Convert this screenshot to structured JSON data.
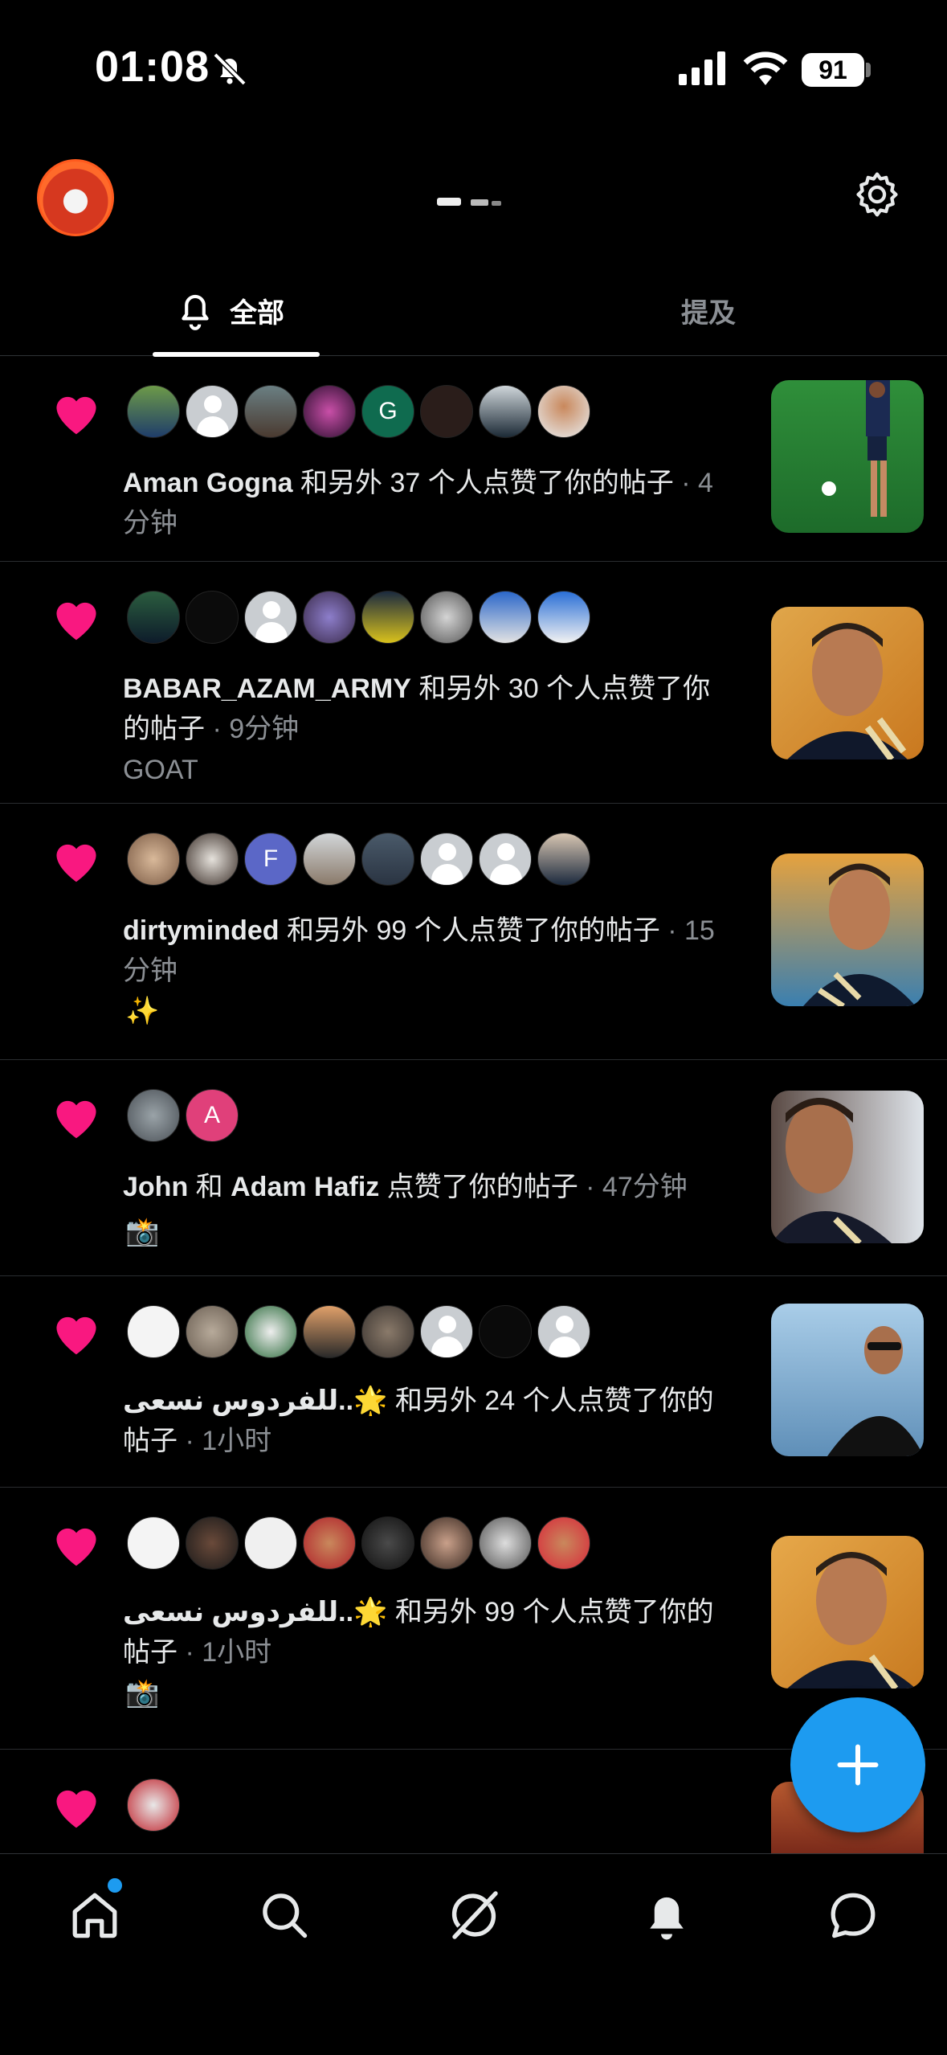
{
  "status_bar": {
    "time": "01:08",
    "battery": "91",
    "icons": [
      "bell-off-icon",
      "signal-icon",
      "wifi-icon",
      "battery-icon"
    ]
  },
  "header": {
    "avatar": "profile-avatar",
    "settings_icon": "gear-icon"
  },
  "tabs": [
    {
      "label": "全部",
      "icon": "bell-icon",
      "active": true
    },
    {
      "label": "提及",
      "active": false
    }
  ],
  "notifications": [
    {
      "name": "Aman Gogna",
      "action": " 和另外 37 个人点赞了你的帖子",
      "time": " · 4分钟",
      "sub": "",
      "emoji": ""
    },
    {
      "name": "BABAR_AZAM_ARMY",
      "action": " 和另外 30 个人点赞了你的帖子",
      "time": " · 9分钟",
      "sub": "GOAT",
      "emoji": ""
    },
    {
      "name": "dirtyminded",
      "action": " 和另外 99 个人点赞了你的帖子",
      "time": " · 15分钟",
      "sub": "",
      "emoji": "✨"
    },
    {
      "name": "John",
      "action": " 和 ",
      "name2": "Adam Hafiz",
      "action2": " 点赞了你的帖子",
      "time": " · 47分钟",
      "sub": "",
      "emoji": "📸"
    },
    {
      "name": "للفردوس نسعى..🌟",
      "action": " 和另外 24 个人点赞了你的帖子",
      "time": " · 1小时",
      "sub": "",
      "emoji": ""
    },
    {
      "name": "للفردوس نسعى..🌟",
      "action": " 和另外 99 个人点赞了你的帖子",
      "time": " · 1小时",
      "sub": "",
      "emoji": "📸"
    }
  ],
  "avatar_letters": {
    "g": "G",
    "f": "F",
    "a": "A"
  },
  "fab": {
    "icon": "plus-icon"
  },
  "nav": [
    {
      "icon": "home-icon"
    },
    {
      "icon": "search-icon"
    },
    {
      "icon": "grok-icon"
    },
    {
      "icon": "bell-icon"
    },
    {
      "icon": "messages-icon"
    }
  ],
  "colors": {
    "accent": "#1d9bf0",
    "heart": "#f91880",
    "bg": "#000000"
  }
}
